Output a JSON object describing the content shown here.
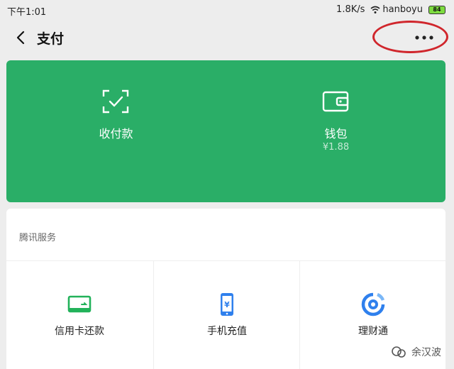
{
  "status_bar": {
    "time": "下午1:01",
    "speed": "1.8K/s",
    "carrier": "hanboyu",
    "battery": "84"
  },
  "nav": {
    "title": "支付"
  },
  "wallet_panel": {
    "receive_pay_label": "收付款",
    "wallet_label": "钱包",
    "wallet_balance": "¥1.88"
  },
  "services": {
    "section_title": "腾讯服务",
    "items": [
      {
        "label": "信用卡还款",
        "icon": "credit-card-icon"
      },
      {
        "label": "手机充值",
        "icon": "phone-recharge-icon"
      },
      {
        "label": "理财通",
        "icon": "wealth-icon"
      }
    ]
  },
  "watermark": {
    "text": "余汉波"
  },
  "colors": {
    "panel_green": "#2aae67",
    "highlight_red": "#d0262c",
    "credit_green": "#22b25a",
    "phone_blue": "#2f80ed"
  }
}
